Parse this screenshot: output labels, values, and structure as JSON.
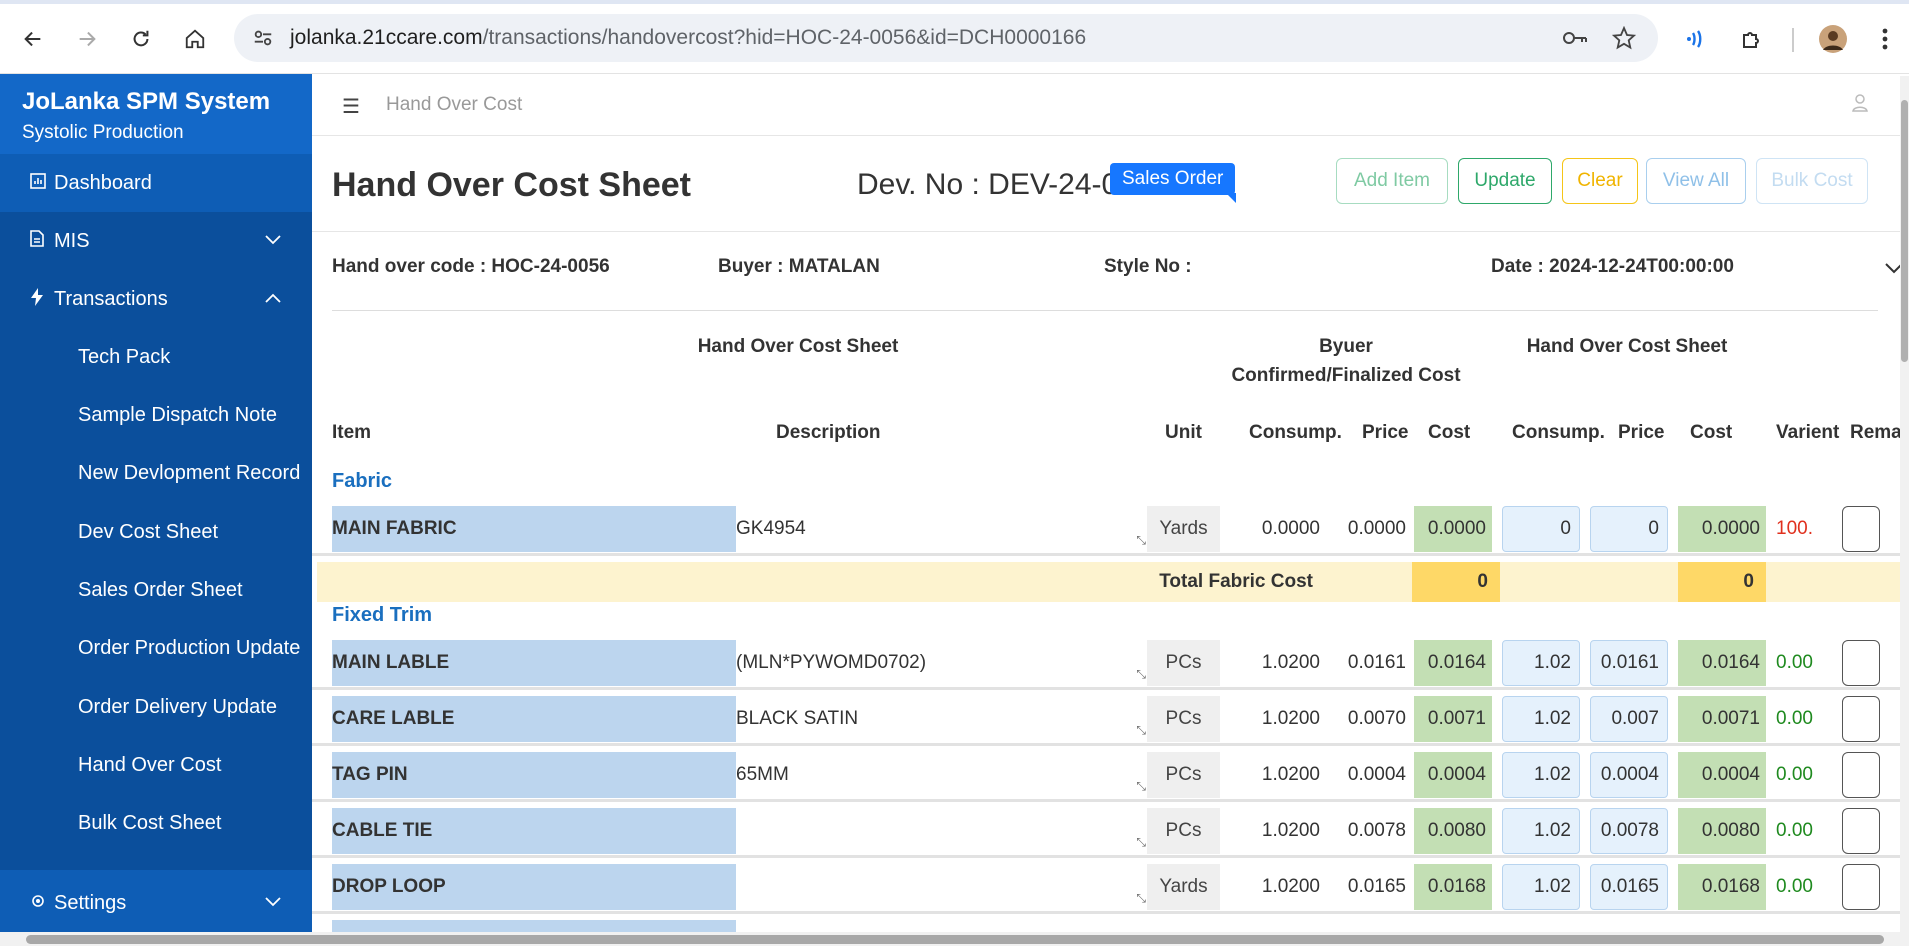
{
  "browser": {
    "url_host": "jolanka.21ccare.com",
    "url_path": "/transactions/handovercost?hid=HOC-24-0056&id=DCH0000166"
  },
  "sidebar": {
    "brand_title": "JoLanka SPM System",
    "brand_subtitle": "Systolic Production",
    "items": [
      {
        "label": "Dashboard",
        "icon": "chart-icon"
      },
      {
        "label": "MIS",
        "icon": "document-icon"
      },
      {
        "label": "Transactions",
        "icon": "bolt-icon"
      },
      {
        "label": "Settings",
        "icon": "gear-icon"
      }
    ],
    "sub_items": [
      "Tech Pack",
      "Sample Dispatch Note",
      "New Devlopment Record",
      "Dev Cost Sheet",
      "Sales Order Sheet",
      "Order Production Update",
      "Order Delivery Update",
      "Hand Over Cost",
      "Bulk Cost Sheet"
    ]
  },
  "topbar": {
    "breadcrumb": "Hand Over Cost"
  },
  "header": {
    "title": "Hand Over Cost Sheet",
    "dev_no": "Dev. No : DEV-24-02",
    "sales_order_tag": "Sales Order",
    "buttons": {
      "add_item": "Add Item",
      "update": "Update",
      "clear": "Clear",
      "view_all": "View All",
      "bulk_cost": "Bulk Cost"
    }
  },
  "info": {
    "handover_code": "Hand over code : HOC-24-0056",
    "buyer": "Buyer : MATALAN",
    "style_no": "Style No :",
    "date": "Date : 2024-12-24T00:00:00"
  },
  "table": {
    "group_headers": {
      "left": "Hand Over Cost Sheet",
      "middle_line1": "Byuer",
      "middle_line2": "Confirmed/Finalized Cost",
      "right": "Hand Over Cost Sheet"
    },
    "columns": {
      "item": "Item",
      "description": "Description",
      "unit": "Unit",
      "consump1": "Consump.",
      "price1": "Price",
      "cost1": "Cost",
      "consump2": "Consump.",
      "price2": "Price",
      "cost2": "Cost",
      "varient": "Varient",
      "remarks": "Rema"
    },
    "sections": [
      {
        "name": "Fabric",
        "rows": [
          {
            "item": "MAIN FABRIC",
            "desc": "GK4954",
            "unit": "Yards",
            "consump": "0.0000",
            "price": "0.0000",
            "cost": "0.0000",
            "consump2": "0",
            "price2": "0",
            "cost2": "0.0000",
            "varient": "100."
          }
        ],
        "total_label": "Total Fabric Cost",
        "total_buyer": "0",
        "total_handover": "0"
      },
      {
        "name": "Fixed Trim",
        "rows": [
          {
            "item": "MAIN LABLE",
            "desc": "(MLN*PYWOMD0702)",
            "unit": "PCs",
            "consump": "1.0200",
            "price": "0.0161",
            "cost": "0.0164",
            "consump2": "1.02",
            "price2": "0.0161",
            "cost2": "0.0164",
            "varient": "0.00"
          },
          {
            "item": "CARE LABLE",
            "desc": "BLACK SATIN",
            "unit": "PCs",
            "consump": "1.0200",
            "price": "0.0070",
            "cost": "0.0071",
            "consump2": "1.02",
            "price2": "0.007",
            "cost2": "0.0071",
            "varient": "0.00"
          },
          {
            "item": "TAG PIN",
            "desc": "65MM",
            "unit": "PCs",
            "consump": "1.0200",
            "price": "0.0004",
            "cost": "0.0004",
            "consump2": "1.02",
            "price2": "0.0004",
            "cost2": "0.0004",
            "varient": "0.00"
          },
          {
            "item": "CABLE TIE",
            "desc": "",
            "unit": "PCs",
            "consump": "1.0200",
            "price": "0.0078",
            "cost": "0.0080",
            "consump2": "1.02",
            "price2": "0.0078",
            "cost2": "0.0080",
            "varient": "0.00"
          },
          {
            "item": "DROP LOOP",
            "desc": "",
            "unit": "Yards",
            "consump": "1.0200",
            "price": "0.0165",
            "cost": "0.0168",
            "consump2": "1.02",
            "price2": "0.0165",
            "cost2": "0.0168",
            "varient": "0.00"
          }
        ]
      }
    ]
  },
  "colors": {
    "sidebar_bg": "#0e5db5",
    "item_cell_bg": "#bcd5ee",
    "cost_cell_bg": "#c3dfb4",
    "total_row_bg": "#fdf3cf",
    "total_value_bg": "#fed867",
    "varient_red": "#e0301e",
    "varient_green": "#1f8a1f"
  }
}
